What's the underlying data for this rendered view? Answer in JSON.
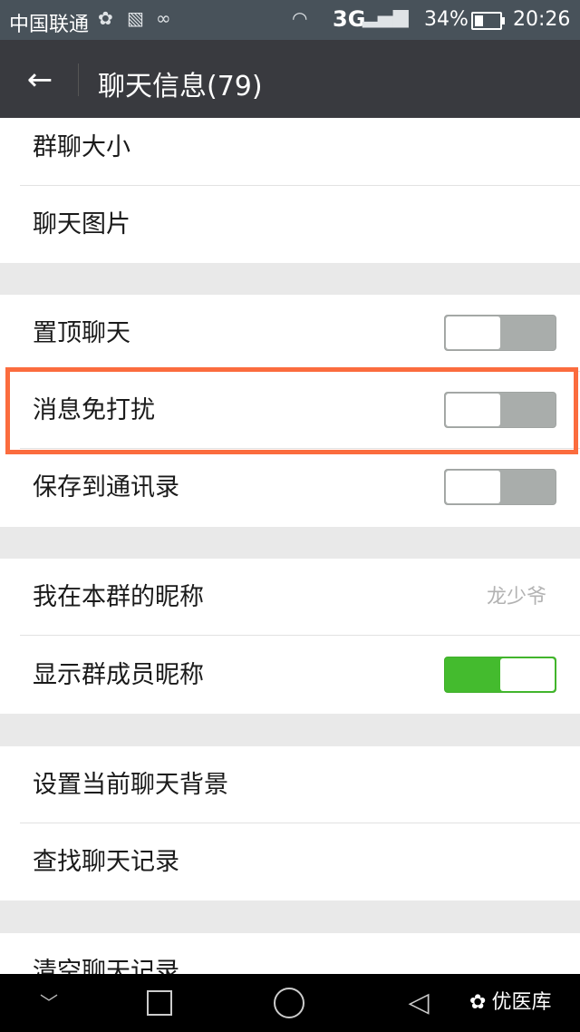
{
  "status_bar": {
    "carrier": "中国联通",
    "icons": [
      "wechat-icon",
      "image-icon",
      "voicemail-icon",
      "wifi-icon",
      "signal-icon"
    ],
    "network": "3G",
    "battery_percent": "34%",
    "battery_level": 0.34,
    "time": "20:26"
  },
  "title_bar": {
    "back_icon": "arrow-left-icon",
    "title": "聊天信息(79)"
  },
  "groups": {
    "group1": {
      "items": [
        "群聊大小",
        "聊天图片"
      ]
    },
    "group2": {
      "items": [
        {
          "label": "置顶聊天",
          "toggle": "off"
        },
        {
          "label": "消息免打扰",
          "toggle": "off",
          "highlighted": true
        },
        {
          "label": "保存到通讯录",
          "toggle": "off"
        }
      ]
    },
    "group3": {
      "items": [
        {
          "label": "我在本群的昵称",
          "value": "龙少爷"
        },
        {
          "label": "显示群成员昵称",
          "toggle": "on"
        }
      ]
    },
    "group4": {
      "items": [
        "设置当前聊天背景",
        "查找聊天记录"
      ]
    },
    "group5": {
      "items": [
        "清空聊天记录"
      ]
    }
  },
  "colors": {
    "title_bar": "#393a3f",
    "toggle_on": "#44bb2e",
    "toggle_off": "#a9adab",
    "highlight_border": "#fb6c3e"
  },
  "nav_bar": {
    "buttons": [
      "chevron-down-icon",
      "recent-apps-icon",
      "home-icon",
      "back-triangle-icon"
    ],
    "watermark": "优医库"
  }
}
